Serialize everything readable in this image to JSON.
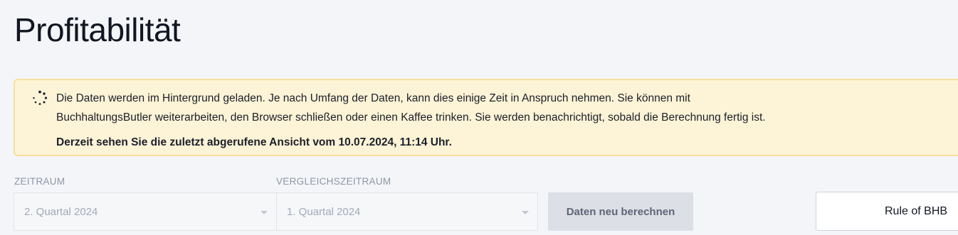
{
  "page": {
    "title": "Profitabilität"
  },
  "notice": {
    "icon": "loading-spinner-icon",
    "line1": "Die Daten werden im Hintergrund geladen. Je nach Umfang der Daten, kann dies einige Zeit in Anspruch nehmen. Sie können mit",
    "line2": "BuchhaltungsButler weiterarbeiten, den Browser schließen oder einen Kaffee trinken. Sie werden benachrichtigt, sobald die Berechnung fertig ist.",
    "current_view": "Derzeit sehen Sie die zuletzt abgerufene Ansicht vom 10.07.2024, 11:14 Uhr.",
    "background_color": "#fdf3d6",
    "border_color": "#f8dfa0"
  },
  "filters": {
    "period": {
      "label": "ZEITRAUM",
      "value": "2. Quartal 2024"
    },
    "comparison_period": {
      "label": "VERGLEICHSZEITRAUM",
      "value": "1. Quartal 2024"
    }
  },
  "actions": {
    "recalculate_label": "Daten neu berechnen",
    "rule_label": "Rule of BHB"
  }
}
